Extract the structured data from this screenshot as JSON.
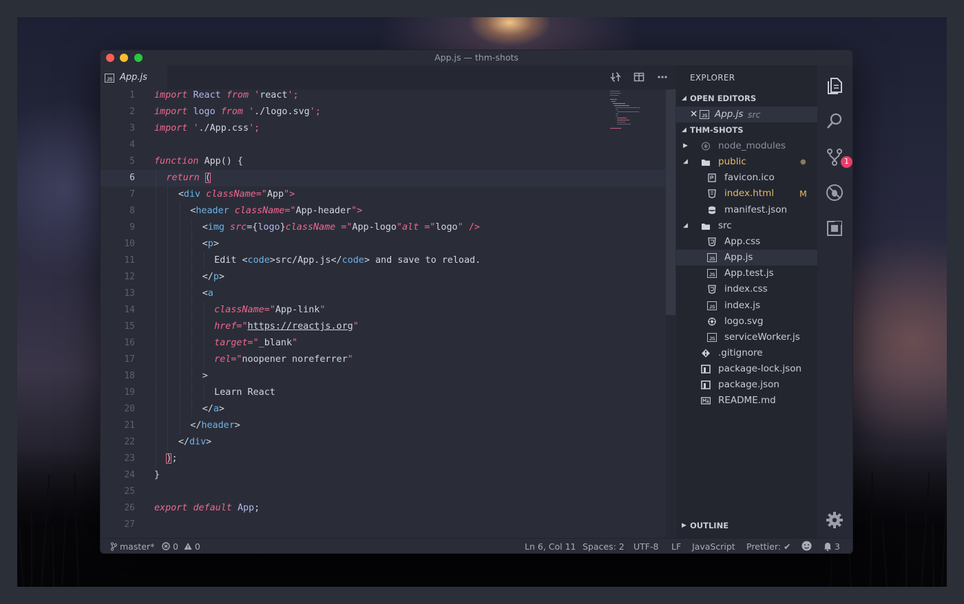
{
  "window": {
    "title": "App.js — thm-shots"
  },
  "editor": {
    "tab_label": "App.js",
    "current_line": 6,
    "lines": [
      {
        "n": "1"
      },
      {
        "n": "2"
      },
      {
        "n": "3"
      },
      {
        "n": "4"
      },
      {
        "n": "5"
      },
      {
        "n": "6"
      },
      {
        "n": "7"
      },
      {
        "n": "8"
      },
      {
        "n": "9"
      },
      {
        "n": "10"
      },
      {
        "n": "11"
      },
      {
        "n": "12"
      },
      {
        "n": "13"
      },
      {
        "n": "14"
      },
      {
        "n": "15"
      },
      {
        "n": "16"
      },
      {
        "n": "17"
      },
      {
        "n": "18"
      },
      {
        "n": "19"
      },
      {
        "n": "20"
      },
      {
        "n": "21"
      },
      {
        "n": "22"
      },
      {
        "n": "23"
      },
      {
        "n": "24"
      },
      {
        "n": "25"
      },
      {
        "n": "26"
      },
      {
        "n": "27"
      }
    ],
    "code": {
      "l1": [
        "import",
        "React",
        "from",
        "'",
        "react",
        "';"
      ],
      "l2": [
        "import",
        "logo",
        "from",
        "'",
        "./logo.svg",
        "';"
      ],
      "l3": [
        "import",
        "'",
        "./App.css",
        "';"
      ],
      "l5": [
        "function",
        "App() {"
      ],
      "l6": [
        "return",
        "("
      ],
      "l7": [
        "<",
        "div",
        "className",
        "=\"",
        "App",
        "\">"
      ],
      "l8": [
        "<",
        "header",
        "className",
        "=\"",
        "App-header",
        "\">"
      ],
      "l9": [
        "<",
        "img",
        "src",
        "={",
        "logo",
        "}",
        "className",
        "=\"",
        "App-logo",
        "\"",
        "alt",
        "=\"",
        "logo",
        "\" />"
      ],
      "l10": [
        "<",
        "p",
        ">"
      ],
      "l11": [
        "Edit <",
        "code",
        ">src/App.js</",
        "code",
        "> and save to reload."
      ],
      "l12": [
        "</",
        "p",
        ">"
      ],
      "l13": [
        "<",
        "a"
      ],
      "l14": [
        "className",
        "=\"",
        "App-link",
        "\""
      ],
      "l15": [
        "href",
        "=\"",
        "https://reactjs.org",
        "\""
      ],
      "l16": [
        "target",
        "=\"",
        "_blank",
        "\""
      ],
      "l17": [
        "rel",
        "=\"",
        "noopener noreferrer",
        "\""
      ],
      "l18": [
        ">"
      ],
      "l19": [
        "Learn React"
      ],
      "l20": [
        "</",
        "a",
        ">"
      ],
      "l21": [
        "</",
        "header",
        ">"
      ],
      "l22": [
        "</",
        "div",
        ">"
      ],
      "l23": [
        ")",
        ";"
      ],
      "l24": [
        "}"
      ],
      "l26": [
        "export",
        "default",
        "App",
        ";"
      ]
    }
  },
  "sidebar": {
    "title": "EXPLORER",
    "open_editors_label": "OPEN EDITORS",
    "open_editor": {
      "name": "App.js",
      "dir": "src"
    },
    "project_label": "THM-SHOTS",
    "outline_label": "OUTLINE",
    "tree": [
      {
        "name": "node_modules"
      },
      {
        "name": "public",
        "status": "●"
      },
      {
        "name": "favicon.ico"
      },
      {
        "name": "index.html",
        "status": "M"
      },
      {
        "name": "manifest.json"
      },
      {
        "name": "src"
      },
      {
        "name": "App.css"
      },
      {
        "name": "App.js"
      },
      {
        "name": "App.test.js"
      },
      {
        "name": "index.css"
      },
      {
        "name": "index.js"
      },
      {
        "name": "logo.svg"
      },
      {
        "name": "serviceWorker.js"
      },
      {
        "name": ".gitignore"
      },
      {
        "name": "package-lock.json"
      },
      {
        "name": "package.json"
      },
      {
        "name": "README.md"
      }
    ]
  },
  "activity": {
    "scm_badge": "1"
  },
  "statusbar": {
    "branch": "master*",
    "errors": "0",
    "warnings": "0",
    "position": "Ln 6, Col 11",
    "spaces": "Spaces: 2",
    "encoding": "UTF-8",
    "eol": "LF",
    "language": "JavaScript",
    "prettier": "Prettier: ✔",
    "notifications": "3"
  },
  "colors": {
    "keyword": "#f0678e",
    "identifier": "#b3b5f1",
    "tag": "#6cb4e8",
    "modified": "#e5b96a",
    "badge": "#ec3d6a"
  }
}
